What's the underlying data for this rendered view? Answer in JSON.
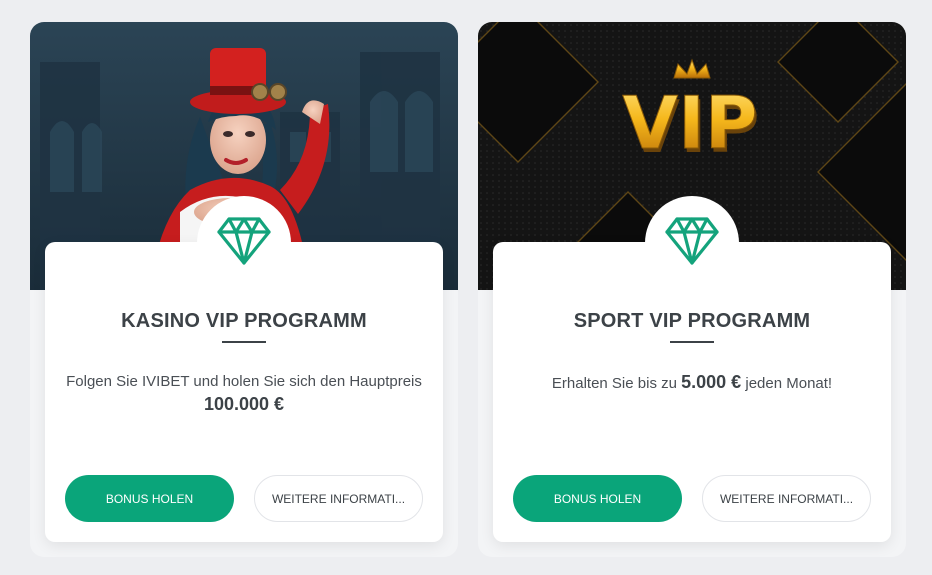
{
  "cards": [
    {
      "banner": "casino-hostess-illustration",
      "icon": "diamond-icon",
      "title": "KASINO VIP PROGRAMM",
      "desc_text": "Folgen Sie IVIBET und holen Sie sich den Hauptpreis",
      "desc_amount": "100.000 €",
      "primary_button": "BONUS HOLEN",
      "secondary_button": "WEITERE INFORMATI..."
    },
    {
      "banner": "vip-crown-logo",
      "banner_text": "VIP",
      "icon": "diamond-icon",
      "title": "SPORT VIP PROGRAMM",
      "desc_prefix": "Erhalten Sie bis zu",
      "desc_amount": "5.000 €",
      "desc_suffix": "jeden Monat!",
      "primary_button": "BONUS HOLEN",
      "secondary_button": "WEITERE INFORMATI..."
    }
  ],
  "colors": {
    "accent": "#0aa57a",
    "diamond": "#14a37c",
    "page_bg": "#edeef1",
    "title": "#3c4247"
  }
}
